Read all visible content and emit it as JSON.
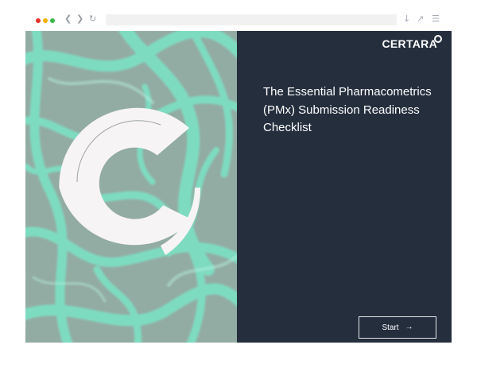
{
  "browser": {
    "traffic_lights": {
      "close": "#e8322c",
      "minimize": "#f3b300",
      "maximize": "#3cb94c"
    },
    "icons": {
      "back": "chevron-left-icon",
      "forward": "chevron-right-icon",
      "reload": "reload-icon",
      "download": "download-icon",
      "expand": "expand-icon",
      "menu": "menu-icon"
    }
  },
  "brand": {
    "name": "CERTARA",
    "mark": "ring-icon"
  },
  "hero": {
    "title": "The Essential Pharmacometrics (PMx) Submission Readiness Checklist"
  },
  "actions": {
    "start_label": "Start",
    "start_icon": "arrow-right-icon"
  },
  "colors": {
    "panel": "#242e3d",
    "ribbon": "#77e6c8",
    "ring": "#f7f4f5"
  }
}
